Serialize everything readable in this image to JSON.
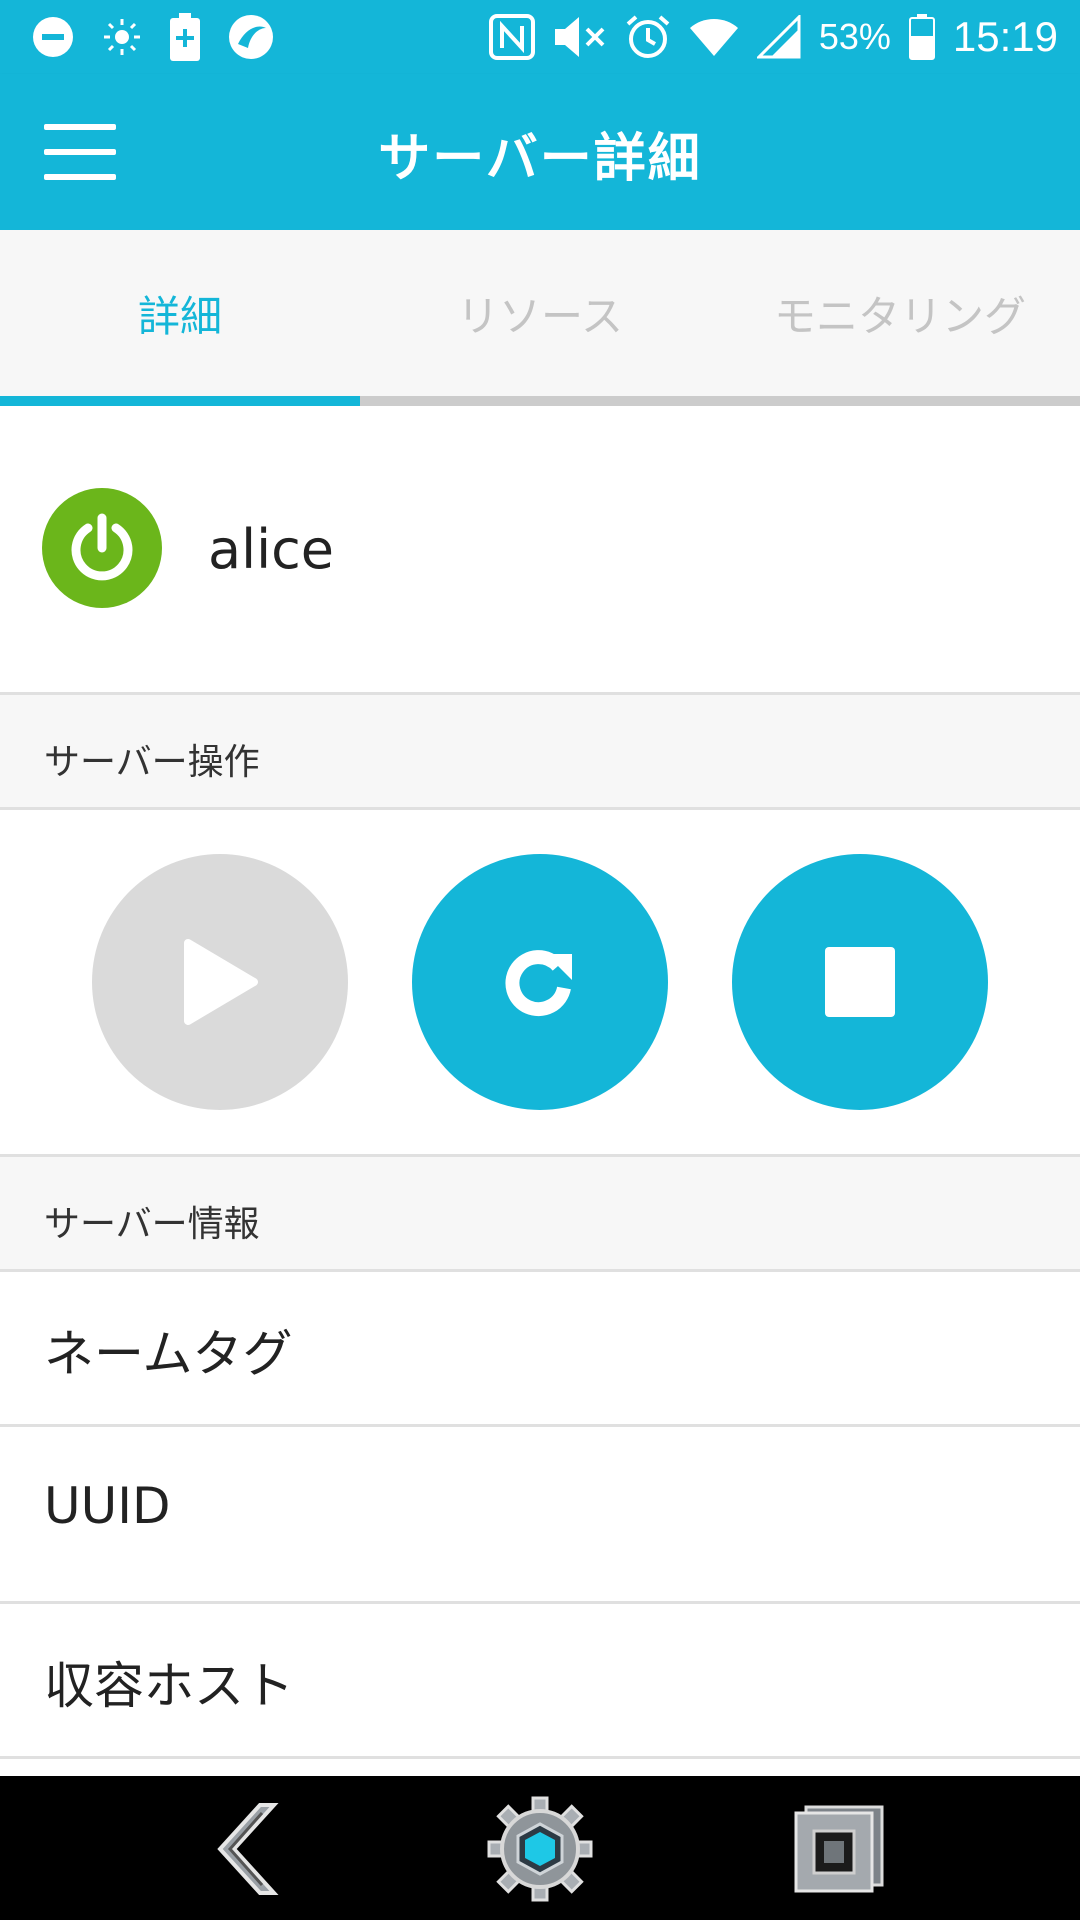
{
  "status_bar": {
    "battery_percent": "53%",
    "time": "15:19",
    "left_icons": [
      "do-not-disturb-icon",
      "brightness-icon",
      "battery-saver-icon",
      "app-icon"
    ],
    "right_icons": [
      "nfc-icon",
      "mute-icon",
      "alarm-icon",
      "wifi-icon",
      "signal-icon",
      "battery-icon"
    ]
  },
  "app_bar": {
    "title": "サーバー詳細",
    "menu_icon": "hamburger-menu-icon"
  },
  "tabs": [
    {
      "label": "詳細",
      "active": true
    },
    {
      "label": "リソース",
      "active": false
    },
    {
      "label": "モニタリング",
      "active": false
    }
  ],
  "server": {
    "name": "alice",
    "status_icon": "power-icon",
    "status_color": "#6bb61b"
  },
  "sections": {
    "operations_title": "サーバー操作",
    "info_title": "サーバー情報"
  },
  "actions": [
    {
      "name": "start",
      "icon": "play-icon",
      "enabled": false
    },
    {
      "name": "restart",
      "icon": "restart-icon",
      "enabled": true
    },
    {
      "name": "stop",
      "icon": "stop-icon",
      "enabled": true
    }
  ],
  "info_items": [
    {
      "label": "ネームタグ"
    },
    {
      "label": "UUID"
    },
    {
      "label": "収容ホスト"
    }
  ],
  "colors": {
    "accent": "#14b6d8",
    "disabled": "#dadada",
    "running": "#6bb61b"
  },
  "nav_bar": {
    "back_icon": "back-icon",
    "home_icon": "home-icon",
    "recents_icon": "recents-icon"
  }
}
